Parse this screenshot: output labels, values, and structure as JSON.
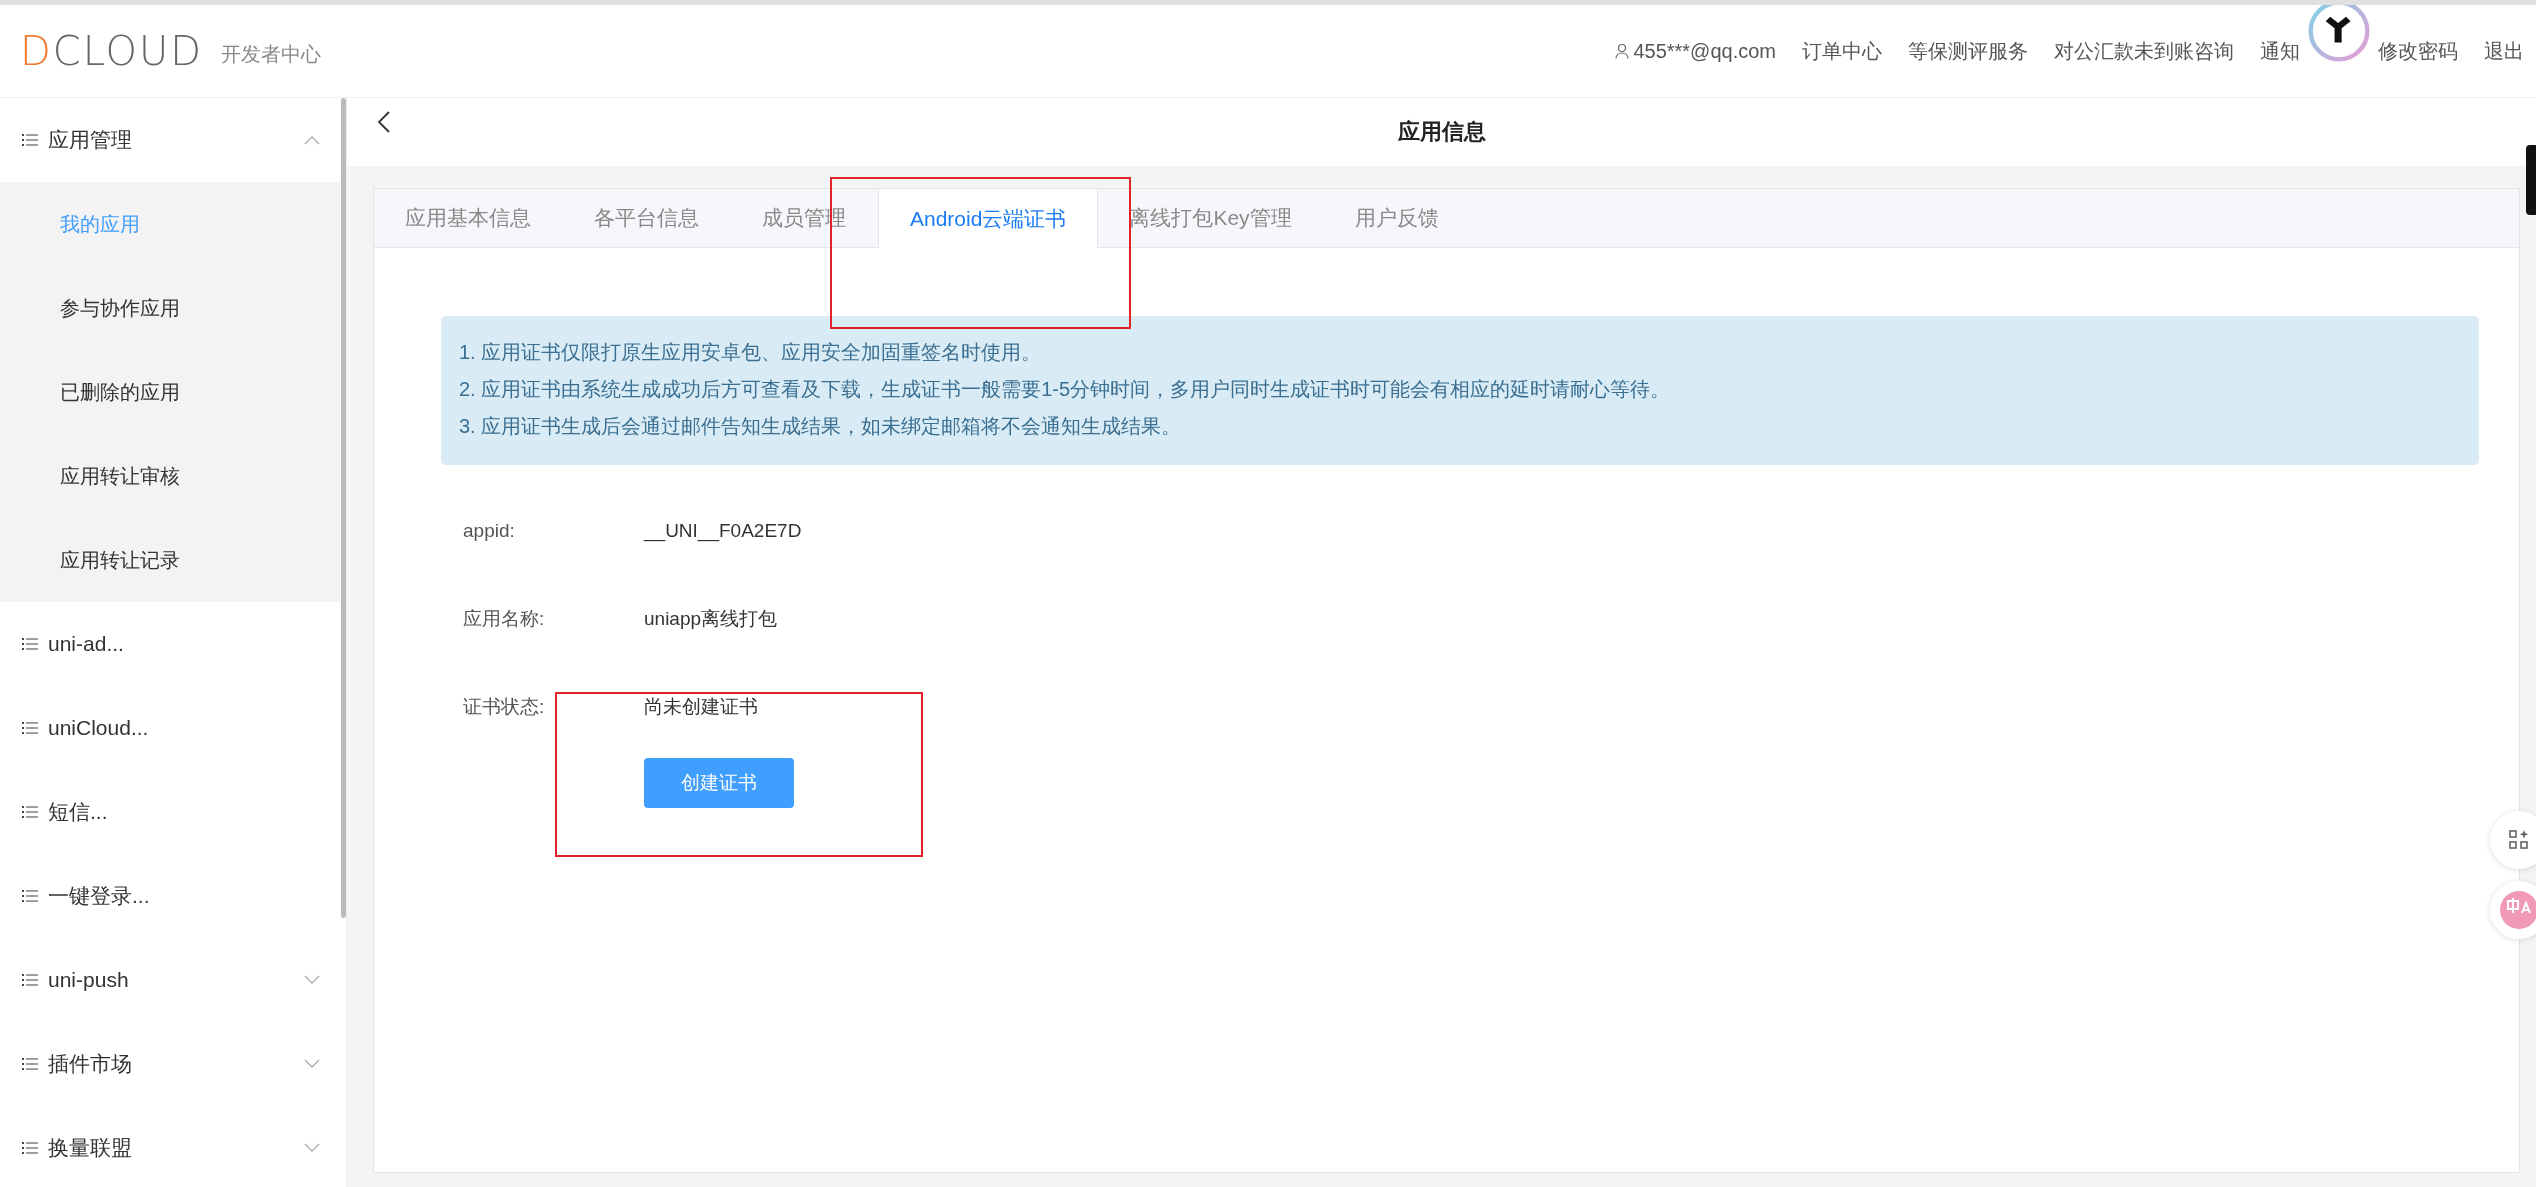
{
  "header": {
    "logo": "DCLOUD",
    "subtitle": "开发者中心",
    "account": "455***@qq.com",
    "links": [
      "订单中心",
      "等保测评服务",
      "对公汇款未到账咨询",
      "通知",
      "修改密码",
      "退出"
    ]
  },
  "sidebar": {
    "items": [
      {
        "kind": "group",
        "label": "应用管理",
        "expanded": true,
        "children": [
          {
            "label": "我的应用",
            "selected": true
          },
          {
            "label": "参与协作应用",
            "selected": false
          },
          {
            "label": "已删除的应用",
            "selected": false
          },
          {
            "label": "应用转让审核",
            "selected": false
          },
          {
            "label": "应用转让记录",
            "selected": false
          }
        ]
      },
      {
        "kind": "link",
        "label": "uni-ad..."
      },
      {
        "kind": "link",
        "label": "uniCloud..."
      },
      {
        "kind": "link",
        "label": "短信..."
      },
      {
        "kind": "link",
        "label": "一键登录..."
      },
      {
        "kind": "group",
        "label": "uni-push",
        "expanded": false
      },
      {
        "kind": "group",
        "label": "插件市场",
        "expanded": false
      },
      {
        "kind": "group",
        "label": "换量联盟",
        "expanded": false
      }
    ]
  },
  "page": {
    "title": "应用信息"
  },
  "tabs": [
    {
      "label": "应用基本信息",
      "selected": false
    },
    {
      "label": "各平台信息",
      "selected": false
    },
    {
      "label": "成员管理",
      "selected": false
    },
    {
      "label": "Android云端证书",
      "selected": true
    },
    {
      "label": "离线打包Key管理",
      "selected": false
    },
    {
      "label": "用户反馈",
      "selected": false
    }
  ],
  "notice": [
    "1. 应用证书仅限打原生应用安卓包、应用安全加固重签名时使用。",
    "2. 应用证书由系统生成成功后方可查看及下载，生成证书一般需要1-5分钟时间，多用户同时生成证书时可能会有相应的延时请耐心等待。",
    "3. 应用证书生成后会通过邮件告知生成结果，如未绑定邮箱将不会通知生成结果。"
  ],
  "fields": [
    {
      "label": "appid:",
      "value": "__UNI__F0A2E7D"
    },
    {
      "label": "应用名称:",
      "value": "uniapp离线打包"
    },
    {
      "label": "证书状态:",
      "value": "尚未创建证书"
    }
  ],
  "button": "创建证书"
}
